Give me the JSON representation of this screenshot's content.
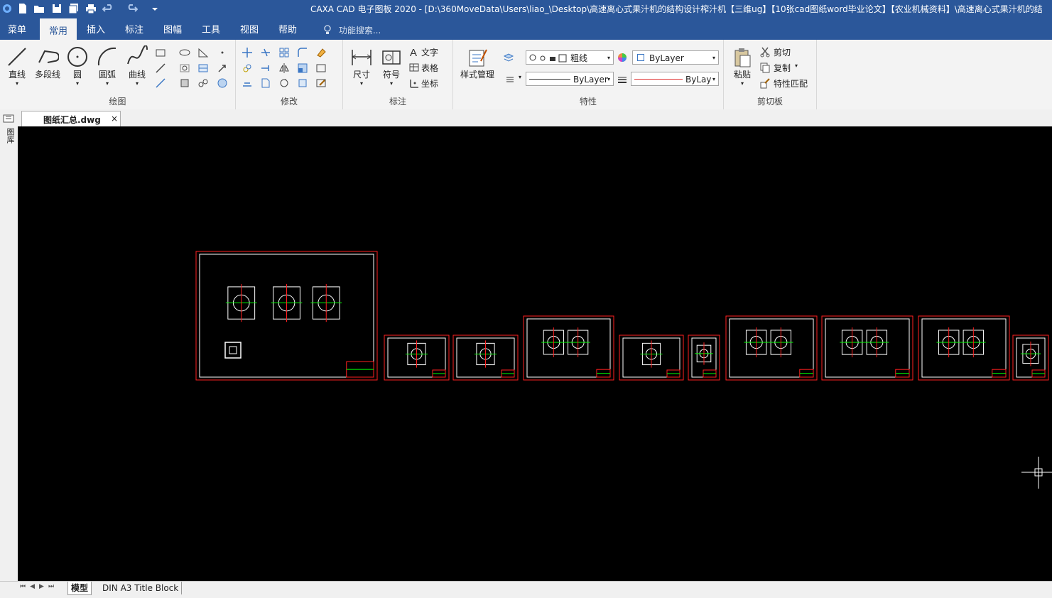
{
  "window": {
    "title": "CAXA CAD 电子图板 2020 - [D:\\360MoveData\\Users\\liao_\\Desktop\\高速离心式果汁机的结构设计榨汁机【三维ug】【10张cad图纸word毕业论文】【农业机械资料】\\高速离心式果汁机的结"
  },
  "menu": {
    "items": [
      "菜单",
      "常用",
      "插入",
      "标注",
      "图幅",
      "工具",
      "视图",
      "帮助"
    ],
    "active": "常用",
    "search_placeholder": "功能搜索..."
  },
  "ribbon": {
    "draw": {
      "label": "绘图",
      "line": "直线",
      "polyline": "多段线",
      "circle": "圆",
      "arc": "圆弧",
      "spline": "曲线"
    },
    "modify": {
      "label": "修改"
    },
    "annotate": {
      "label": "标注",
      "dimension": "尺寸",
      "symbol": "符号",
      "text": "文字",
      "table": "表格",
      "coord": "坐标"
    },
    "properties": {
      "label": "特性",
      "style_manager": "样式管理",
      "layer_name": "粗线",
      "color": "ByLayer",
      "linetype": "ByLayer",
      "lineweight": "ByLay"
    },
    "clipboard": {
      "label": "剪切板",
      "paste": "粘贴",
      "cut": "剪切",
      "copy": "复制",
      "match": "特性匹配"
    }
  },
  "document": {
    "tab_name": "图纸汇总.dwg",
    "close_glyph": "×"
  },
  "sidebar": {
    "label": "图库"
  },
  "layout_tabs": [
    "模型",
    "DIN A3 Title Block"
  ],
  "colors": {
    "titlebar": "#2b579a",
    "canvas": "#000000",
    "frame": "#ff2020",
    "drawing": "#ffffff",
    "dimension": "#00ff00"
  }
}
